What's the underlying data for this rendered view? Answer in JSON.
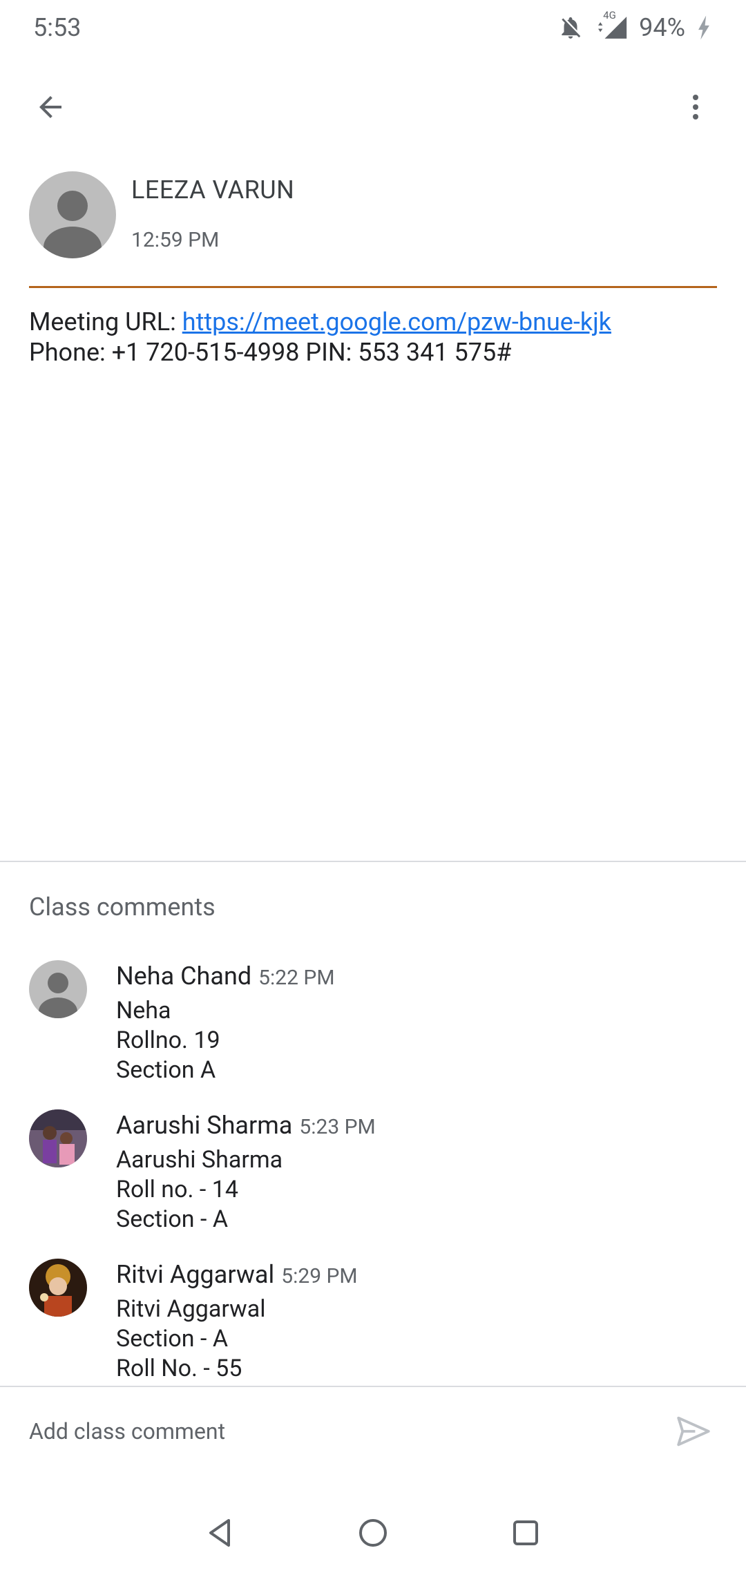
{
  "status_bar": {
    "time": "5:53",
    "network": "4G",
    "battery": "94%",
    "icons": [
      "notifications-off-icon",
      "signal-icon",
      "battery-charging-icon"
    ]
  },
  "app_bar": {
    "icons": [
      "back-arrow-icon",
      "more-vert-icon"
    ]
  },
  "post": {
    "author": "LEEZA VARUN",
    "time": "12:59 PM",
    "meeting_label": "Meeting URL: ",
    "meeting_url": "https://meet.google.com/pzw-bnue-kjk",
    "phone_line": "Phone: +1 720-515-4998 PIN: 553 341 575#"
  },
  "comments_section": {
    "title": "Class comments",
    "comments": [
      {
        "name": "Neha Chand",
        "time": "5:22 PM",
        "lines": [
          "Neha",
          "Rollno. 19",
          "Section A"
        ]
      },
      {
        "name": "Aarushi Sharma",
        "time": "5:23 PM",
        "lines": [
          "Aarushi Sharma",
          "Roll no. - 14",
          "Section - A"
        ]
      },
      {
        "name": "Ritvi Aggarwal",
        "time": "5:29 PM",
        "lines": [
          "Ritvi Aggarwal",
          "Section - A",
          "Roll No. - 55"
        ]
      }
    ]
  },
  "composer": {
    "placeholder": "Add class comment",
    "value": ""
  },
  "colors": {
    "accent_divider": "#b5651d",
    "link": "#1a73e8",
    "secondary_text": "#5f6368"
  }
}
